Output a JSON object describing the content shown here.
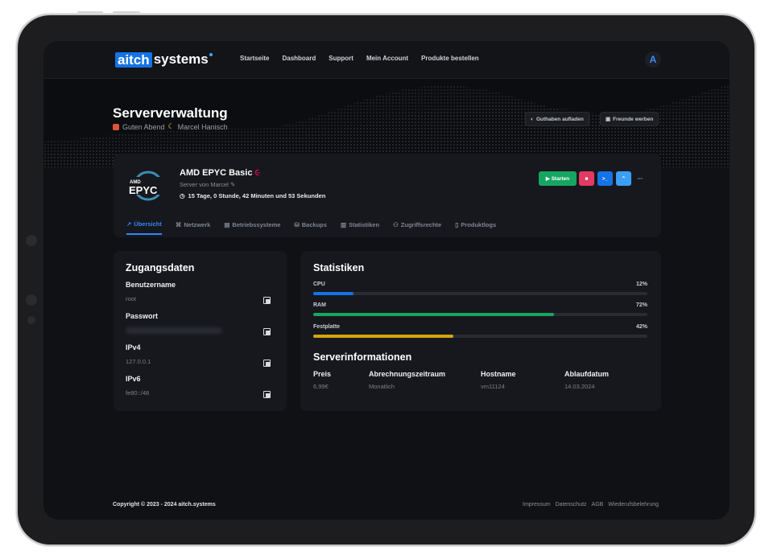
{
  "brand": {
    "logo_box": "aitch",
    "logo_text": "systems",
    "accent": "#1473e6"
  },
  "nav": {
    "items": [
      "Startseite",
      "Dashboard",
      "Support",
      "Mein Account",
      "Produkte bestellen"
    ]
  },
  "avatar": {
    "letter": "A"
  },
  "hero": {
    "title": "Serververwaltung",
    "greeting": "Guten Abend",
    "user": "Marcel Hanisch",
    "buttons": [
      "Guthaben aufladen",
      "Freunde werben"
    ]
  },
  "server": {
    "logo_brand": "AMD",
    "logo_model": "EPYC",
    "name": "AMD EPYC Basic",
    "owner": "Server von Marcel",
    "uptime": "15 Tage, 0 Stunde, 42 Minuten und 53 Sekunden",
    "start_label": "Starten",
    "more_label": "···",
    "tabs": [
      "Übersicht",
      "Netzwerk",
      "Betriebssysteme",
      "Backups",
      "Statistiken",
      "Zugriffsrechte",
      "Produktlogs"
    ]
  },
  "access": {
    "title": "Zugangsdaten",
    "username_label": "Benutzername",
    "username": "root",
    "password_label": "Passwort",
    "ipv4_label": "IPv4",
    "ipv4": "127.0.0.1",
    "ipv6_label": "IPv6",
    "ipv6": "fe80::/48"
  },
  "stats": {
    "title": "Statistiken",
    "items": [
      {
        "name": "CPU",
        "pct": "12%",
        "value": 12,
        "color": "#1473e6"
      },
      {
        "name": "RAM",
        "pct": "72%",
        "value": 72,
        "color": "#16a663"
      },
      {
        "name": "Festplatte",
        "pct": "42%",
        "value": 42,
        "color": "#d4a510"
      }
    ]
  },
  "info": {
    "title": "Serverinformationen",
    "preis_label": "Preis",
    "preis": "6,99€",
    "abrechnung_label": "Abrechnungszeitraum",
    "abrechnung": "Monatlich",
    "hostname_label": "Hostname",
    "hostname": "vm11124",
    "ablauf_label": "Ablaufdatum",
    "ablauf": "14.03.2024"
  },
  "footer": {
    "copyright": "Copyright © 2023 - 2024 aitch.systems",
    "links": [
      "Impressum",
      "Datenschutz",
      "AGB",
      "Wiederufsbelehrung"
    ]
  }
}
